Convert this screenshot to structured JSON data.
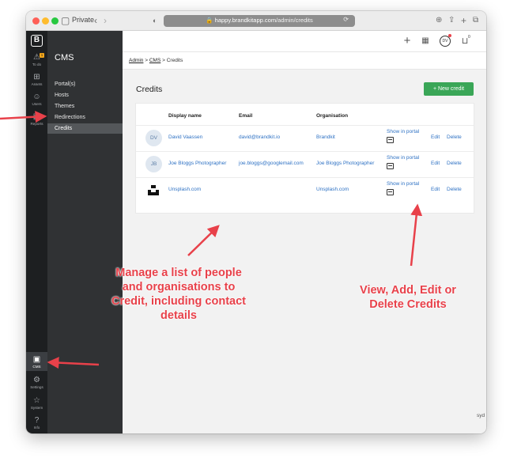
{
  "browser": {
    "private_label": "Private",
    "url_host": "happy.brandkitapp.com",
    "url_path": "/admin/credits"
  },
  "left_nav": {
    "logo": "B",
    "todo_badge": "1",
    "items": [
      {
        "label": "To do",
        "icon": "warning-icon"
      },
      {
        "label": "Assets",
        "icon": "grid-icon"
      },
      {
        "label": "Users",
        "icon": "users-icon"
      },
      {
        "label": "Reports",
        "icon": "reports-icon"
      }
    ],
    "bottom_items": [
      {
        "label": "CMS",
        "icon": "cms-icon"
      },
      {
        "label": "Settings",
        "icon": "wrench-icon"
      },
      {
        "label": "System",
        "icon": "star-icon"
      },
      {
        "label": "Info",
        "icon": "help-icon"
      }
    ]
  },
  "cms_panel": {
    "title": "CMS",
    "items": [
      "Portal(s)",
      "Hosts",
      "Themes",
      "Redirections",
      "Credits"
    ],
    "active": "Credits"
  },
  "topbar": {
    "avatar_initials": "DV",
    "notification_count": "0"
  },
  "breadcrumb": {
    "admin": "Admin",
    "cms": "CMS",
    "current": "Credits",
    "sep": ">"
  },
  "page": {
    "title": "Credits",
    "new_button": "+  New credit"
  },
  "table": {
    "headers": [
      "Display name",
      "Email",
      "Organisation"
    ],
    "portal_label": "Show in portal",
    "edit_label": "Edit",
    "delete_label": "Delete",
    "rows": [
      {
        "initials": "DV",
        "name": "David Vaassen",
        "email": "david@brandkit.io",
        "org": "Brandkit"
      },
      {
        "initials": "JB",
        "name": "Joe Bloggs Photographer",
        "email": "joe.bloggs@googlemail.com",
        "org": "Joe Bloggs Photographer"
      },
      {
        "initials": "",
        "name": "Unsplash.com",
        "email": "",
        "org": "Unsplash.com"
      }
    ]
  },
  "corner_text": "syd",
  "annotations": {
    "left": [
      "Manage a list of people",
      "and organisations to",
      "Credit, including contact",
      "details"
    ],
    "right": [
      "View, Add, Edit or",
      "Delete Credits"
    ]
  },
  "colors": {
    "accent_green": "#3aa657",
    "link_blue": "#2f72c4",
    "annotation_red": "#e8414a",
    "sidebar_dark": "#1d1f21",
    "panel_dark": "#303234"
  }
}
